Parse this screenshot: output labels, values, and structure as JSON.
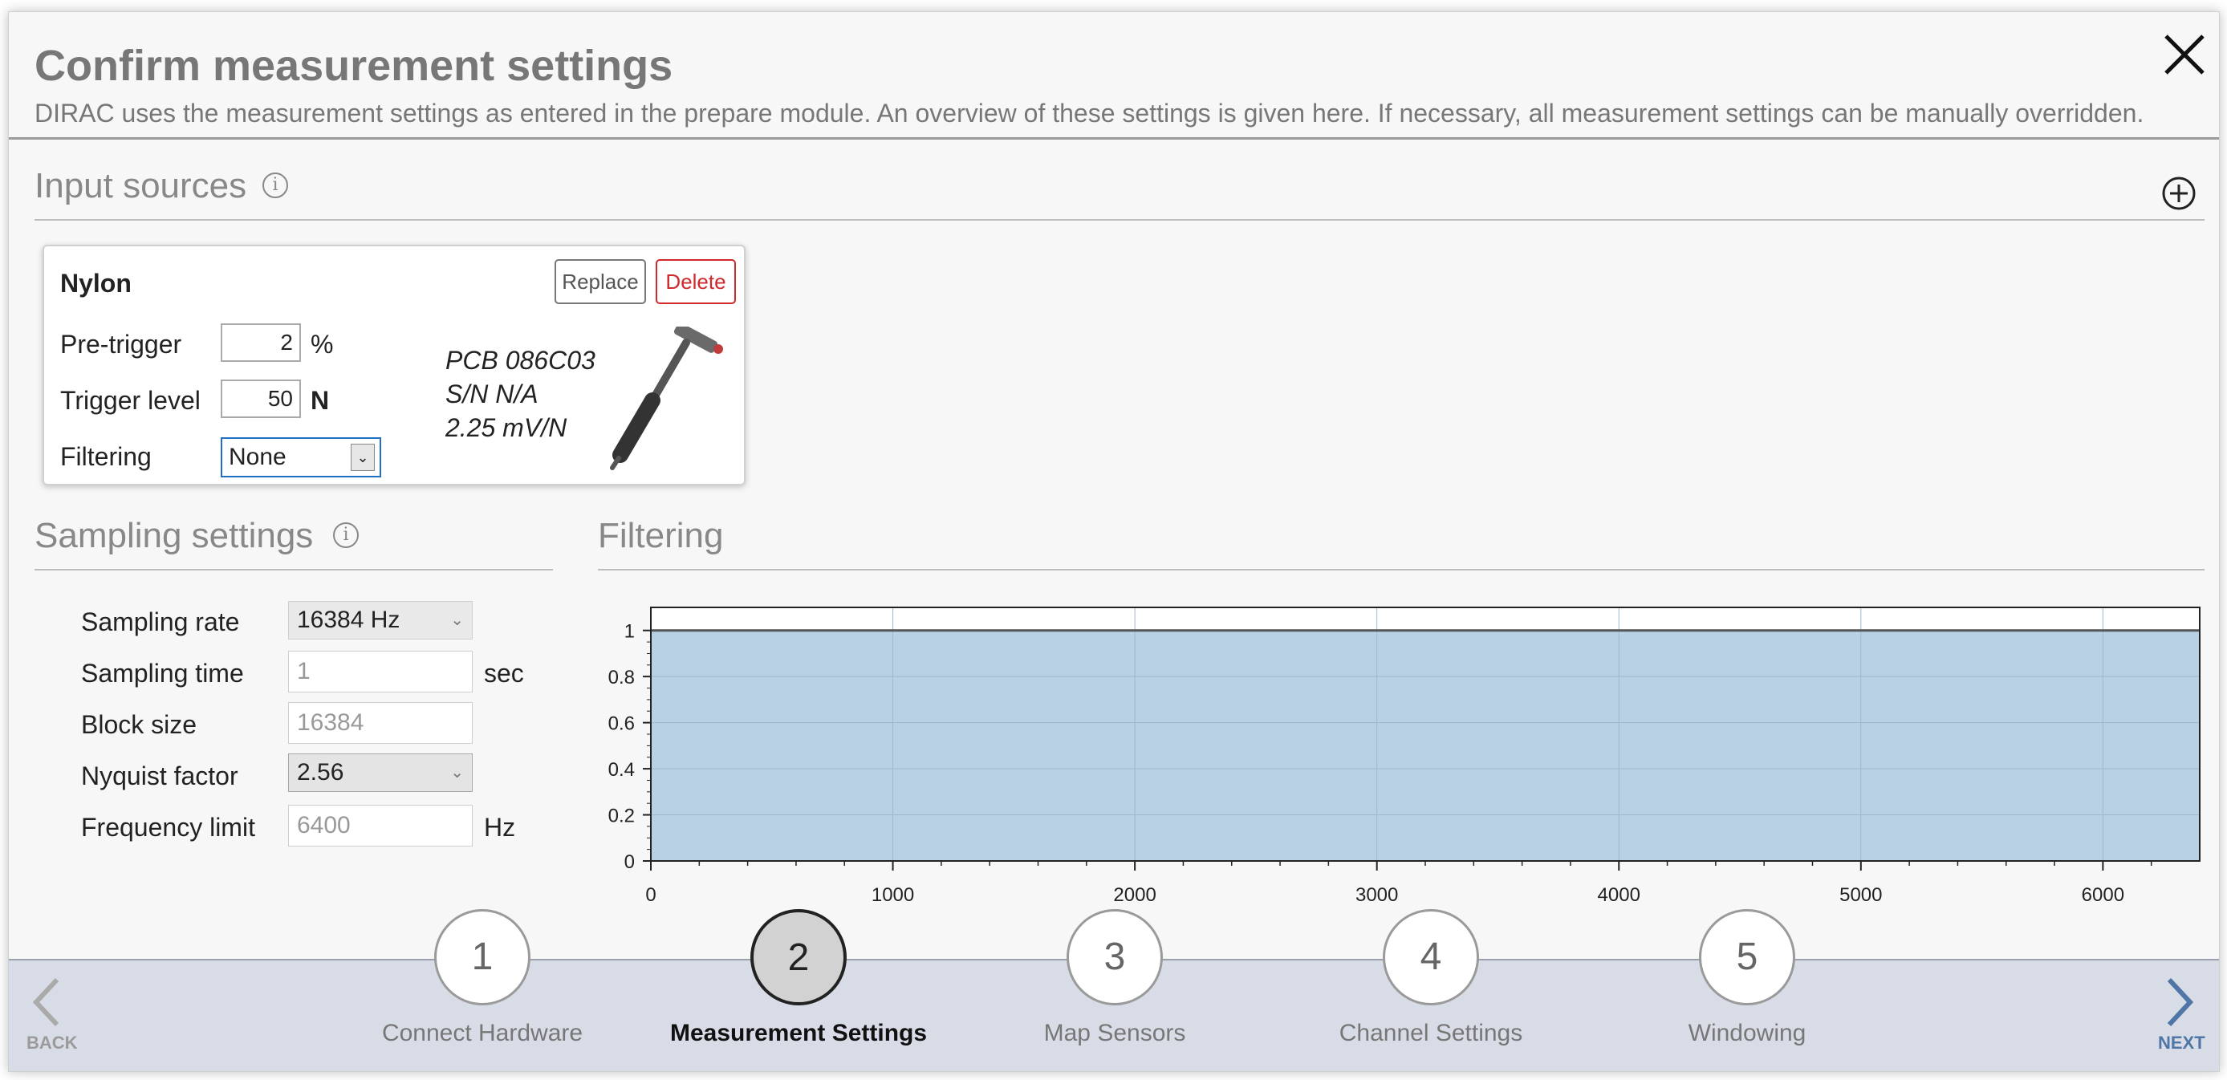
{
  "header": {
    "title": "Confirm measurement settings",
    "subtitle": "DIRAC uses the measurement settings as entered in the prepare module. An overview of these settings is given here. If necessary, all measurement settings can be manually overridden."
  },
  "input_sources": {
    "title": "Input sources",
    "card": {
      "name": "Nylon",
      "replace_label": "Replace",
      "delete_label": "Delete",
      "pretrigger_label": "Pre-trigger",
      "pretrigger_value": "2",
      "pretrigger_unit": "%",
      "trigger_label": "Trigger level",
      "trigger_value": "50",
      "trigger_unit": "N",
      "filtering_label": "Filtering",
      "filtering_value": "None",
      "sensor_model": "PCB 086C03",
      "sensor_serial": "S/N N/A",
      "sensor_sensitivity": "2.25 mV/N"
    }
  },
  "sampling": {
    "title": "Sampling settings",
    "rate_label": "Sampling rate",
    "rate_value": "16384 Hz",
    "time_label": "Sampling time",
    "time_value": "1",
    "time_unit": "sec",
    "block_label": "Block size",
    "block_value": "16384",
    "nyquist_label": "Nyquist factor",
    "nyquist_value": "2.56",
    "freq_label": "Frequency limit",
    "freq_value": "6400",
    "freq_unit": "Hz"
  },
  "filtering": {
    "title": "Filtering"
  },
  "chart_data": {
    "type": "area",
    "x": [
      0,
      6400
    ],
    "values": [
      1,
      1
    ],
    "xlim": [
      0,
      6400
    ],
    "ylim": [
      0,
      1.1
    ],
    "xticks": [
      0,
      1000,
      2000,
      3000,
      4000,
      5000,
      6000
    ],
    "yticks": [
      0,
      0.2,
      0.4,
      0.6,
      0.8,
      1
    ],
    "yticklabels": [
      "0",
      "0.2",
      "0.4",
      "0.6",
      "0.8",
      "1"
    ],
    "grid": true,
    "fill_color": "#b8d1e4",
    "line_color": "#555555",
    "title": "",
    "xlabel": "",
    "ylabel": ""
  },
  "nav": {
    "back_label": "BACK",
    "next_label": "NEXT",
    "steps": [
      {
        "number": "1",
        "label": "Connect Hardware"
      },
      {
        "number": "2",
        "label": "Measurement Settings"
      },
      {
        "number": "3",
        "label": "Map Sensors"
      },
      {
        "number": "4",
        "label": "Channel Settings"
      },
      {
        "number": "5",
        "label": "Windowing"
      }
    ],
    "active_step": 2
  },
  "colors": {
    "delete_red": "#d0292c",
    "focus_blue": "#1f6fc4",
    "nav_bg": "#d8dce6",
    "next_blue": "#4f76a6"
  }
}
